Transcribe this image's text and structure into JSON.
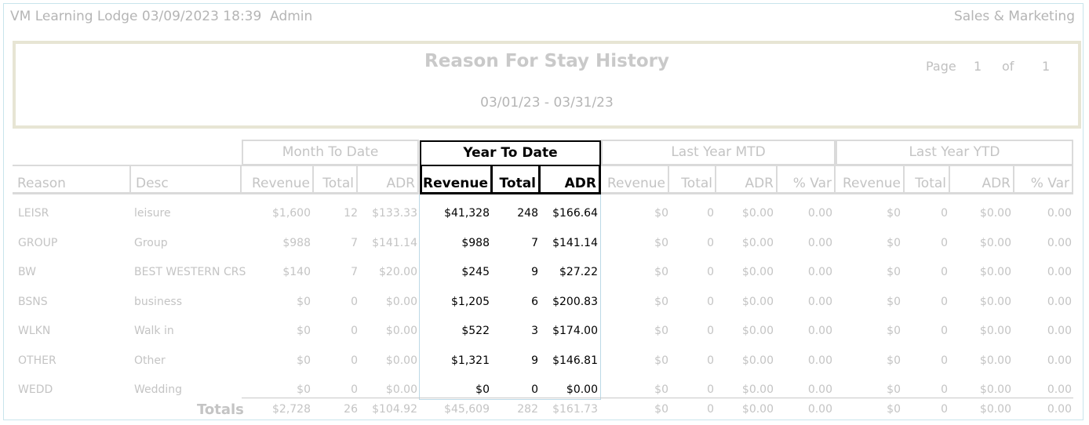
{
  "header": {
    "left": "VM Learning Lodge 03/09/2023 18:39  Admin",
    "right": "Sales & Marketing"
  },
  "report": {
    "title": "Reason For Stay History",
    "date_range": "03/01/23 - 03/31/23",
    "page_label": "Page",
    "page": "1",
    "of_label": "of",
    "pages": "1"
  },
  "groups": {
    "mtd": "Month To Date",
    "ytd": "Year To Date",
    "ly_mtd": "Last Year MTD",
    "ly_ytd": "Last Year YTD"
  },
  "columns": [
    "Reason",
    "Desc",
    "Revenue",
    "Total",
    "ADR",
    "Revenue",
    "Total",
    "ADR",
    "Revenue",
    "Total",
    "ADR",
    "% Var",
    "Revenue",
    "Total",
    "ADR",
    "% Var"
  ],
  "rows": [
    [
      "LEISR",
      "leisure",
      "$1,600",
      "12",
      "$133.33",
      "$41,328",
      "248",
      "$166.64",
      "$0",
      "0",
      "$0.00",
      "0.00",
      "$0",
      "0",
      "$0.00",
      "0.00"
    ],
    [
      "GROUP",
      "Group",
      "$988",
      "7",
      "$141.14",
      "$988",
      "7",
      "$141.14",
      "$0",
      "0",
      "$0.00",
      "0.00",
      "$0",
      "0",
      "$0.00",
      "0.00"
    ],
    [
      "BW",
      "BEST WESTERN CRS",
      "$140",
      "7",
      "$20.00",
      "$245",
      "9",
      "$27.22",
      "$0",
      "0",
      "$0.00",
      "0.00",
      "$0",
      "0",
      "$0.00",
      "0.00"
    ],
    [
      "BSNS",
      "business",
      "$0",
      "0",
      "$0.00",
      "$1,205",
      "6",
      "$200.83",
      "$0",
      "0",
      "$0.00",
      "0.00",
      "$0",
      "0",
      "$0.00",
      "0.00"
    ],
    [
      "WLKN",
      "Walk in",
      "$0",
      "0",
      "$0.00",
      "$522",
      "3",
      "$174.00",
      "$0",
      "0",
      "$0.00",
      "0.00",
      "$0",
      "0",
      "$0.00",
      "0.00"
    ],
    [
      "OTHER",
      "Other",
      "$0",
      "0",
      "$0.00",
      "$1,321",
      "9",
      "$146.81",
      "$0",
      "0",
      "$0.00",
      "0.00",
      "$0",
      "0",
      "$0.00",
      "0.00"
    ],
    [
      "WEDD",
      "Wedding",
      "$0",
      "0",
      "$0.00",
      "$0",
      "0",
      "$0.00",
      "$0",
      "0",
      "$0.00",
      "0.00",
      "$0",
      "0",
      "$0.00",
      "0.00"
    ]
  ],
  "totals": {
    "label": "Totals",
    "values": [
      "$2,728",
      "26",
      "$104.92",
      "$45,609",
      "282",
      "$161.73",
      "$0",
      "0",
      "$0.00",
      "0.00",
      "$0",
      "0",
      "$0.00",
      "0.00"
    ]
  }
}
